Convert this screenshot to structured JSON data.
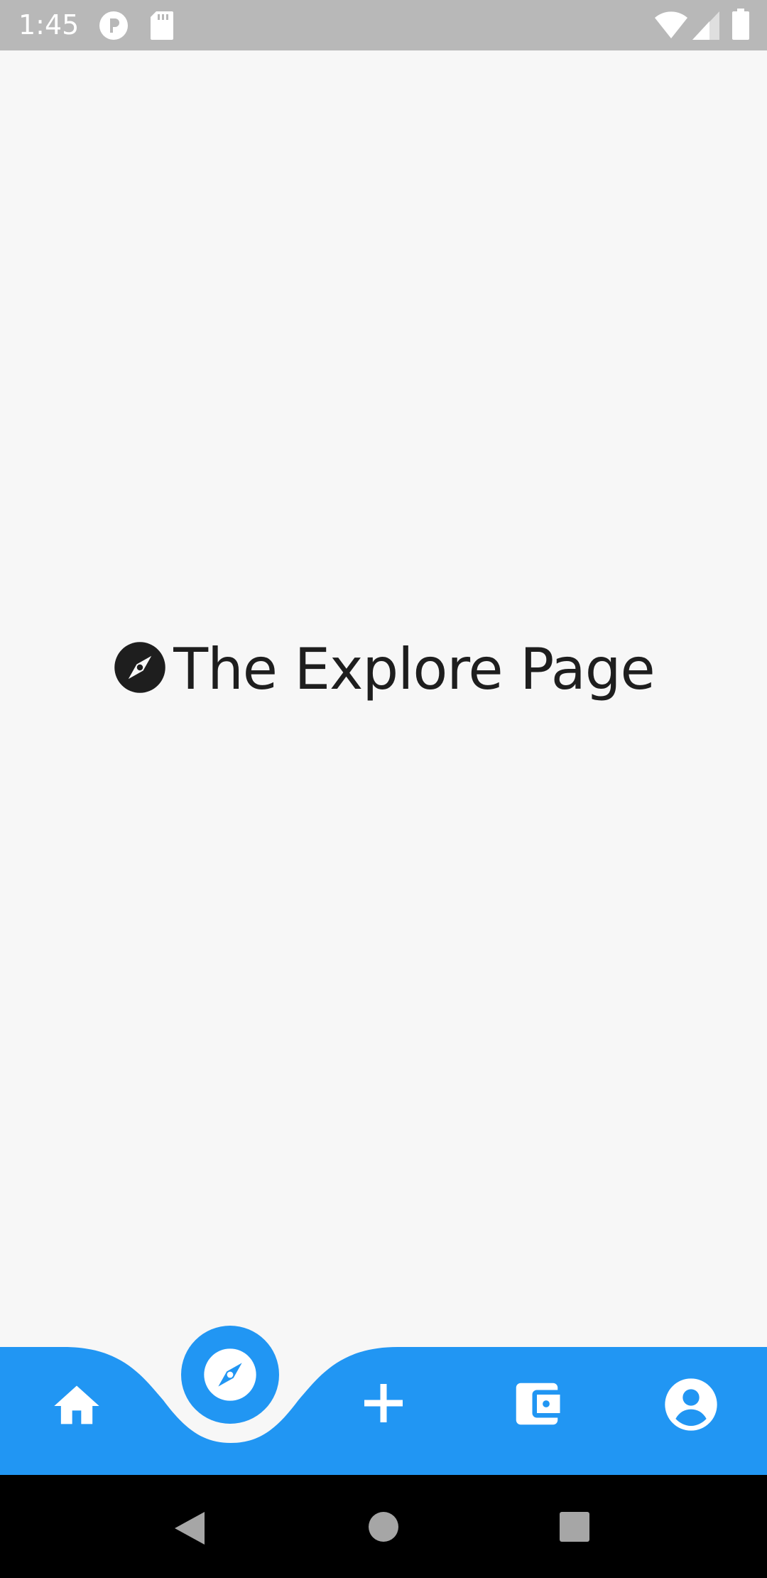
{
  "status_bar": {
    "time": "1:45",
    "icons": [
      "notification-p-icon",
      "sd-card-icon",
      "wifi-icon",
      "signal-icon",
      "battery-icon"
    ]
  },
  "main": {
    "title": "The Explore Page",
    "title_icon": "compass-icon"
  },
  "bottom_nav": {
    "active_item": "explore",
    "items": [
      {
        "id": "home",
        "icon": "home-icon"
      },
      {
        "id": "explore",
        "icon": "compass-icon"
      },
      {
        "id": "add",
        "icon": "plus-icon"
      },
      {
        "id": "wallet",
        "icon": "wallet-icon"
      },
      {
        "id": "account",
        "icon": "account-icon"
      }
    ]
  },
  "system_nav": {
    "buttons": [
      "back-icon",
      "home-circle-icon",
      "recents-icon"
    ]
  },
  "colors": {
    "accent": "#2196f3",
    "background": "#f7f7f7",
    "status_bar": "#b8b8b8",
    "system_nav": "#000000",
    "title_text": "#1e1e1e"
  }
}
